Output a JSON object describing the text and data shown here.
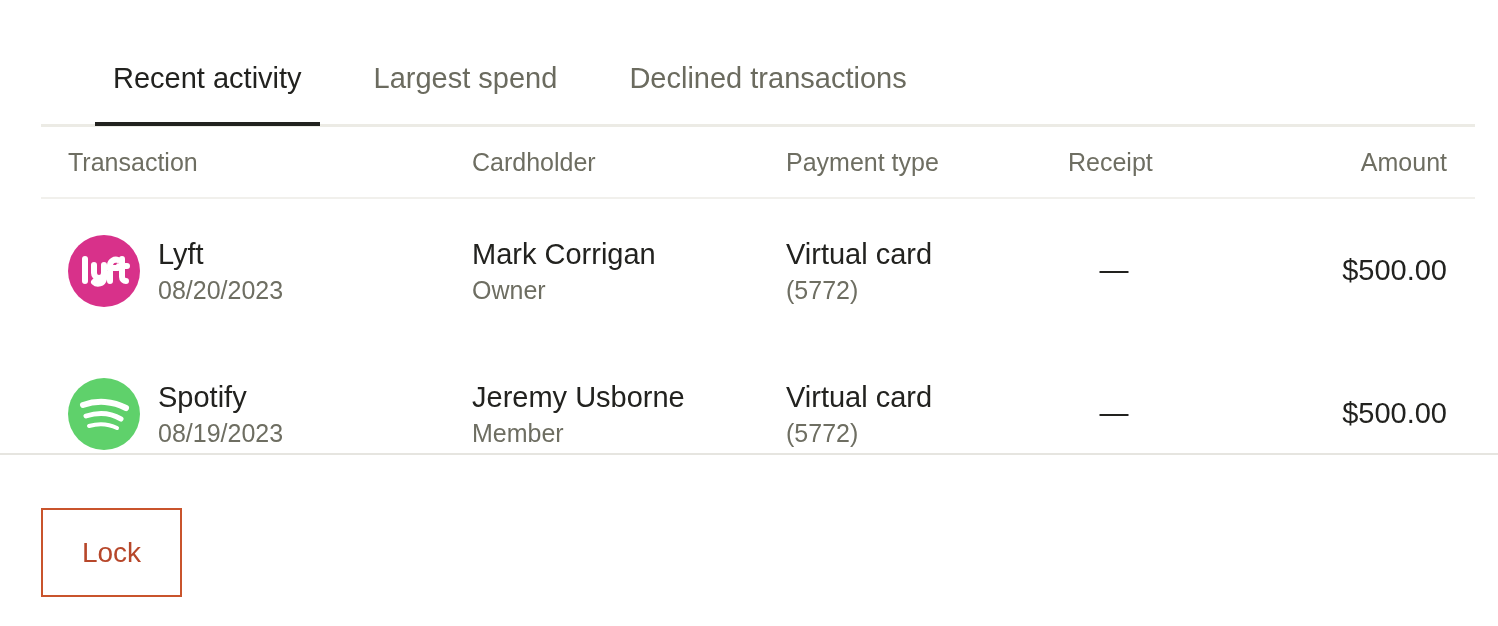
{
  "tabs": [
    {
      "label": "Recent activity",
      "selected": true
    },
    {
      "label": "Largest spend",
      "selected": false
    },
    {
      "label": "Declined transactions",
      "selected": false
    }
  ],
  "table": {
    "columns": [
      "Transaction",
      "Cardholder",
      "Payment type",
      "Receipt",
      "Amount"
    ],
    "rows": [
      {
        "kind": "lyft",
        "merchant": "Lyft",
        "date": "08/20/2023",
        "cardholder": "Mark Corrigan",
        "role": "Owner",
        "payment_type": "Virtual card",
        "card_number": "(5772)",
        "receipt": "—",
        "amount": "$500.00"
      },
      {
        "kind": "spotify",
        "merchant": "Spotify",
        "date": "08/19/2023",
        "cardholder": "Jeremy Usborne",
        "role": "Member",
        "payment_type": "Virtual card",
        "card_number": "(5772)",
        "receipt": "—",
        "amount": "$500.00"
      }
    ]
  },
  "lock_button": "Lock"
}
